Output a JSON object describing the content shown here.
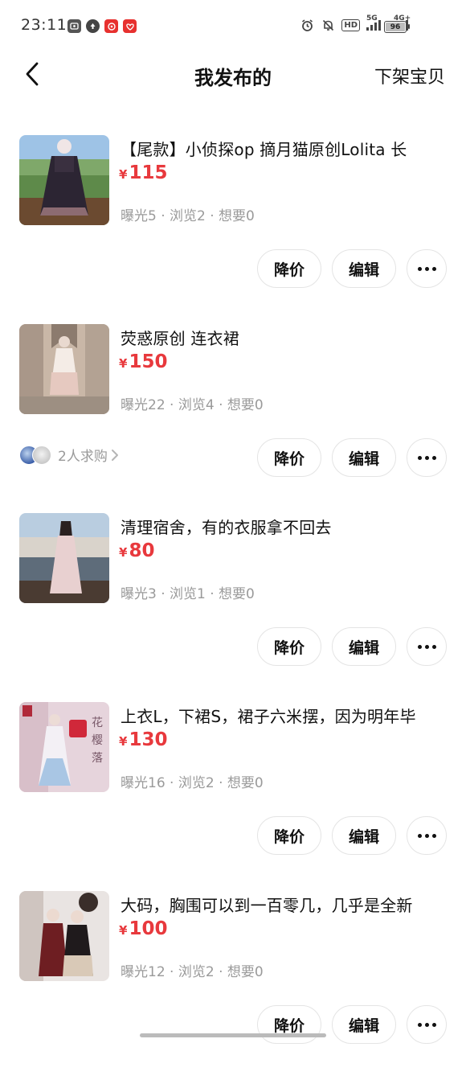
{
  "status_bar": {
    "time": "23:11",
    "battery": "96",
    "hd": "HD",
    "net1": "5G",
    "net2": "4G+"
  },
  "nav": {
    "title": "我发布的",
    "delist_label": "下架宝贝"
  },
  "items": [
    {
      "title": "【尾款】小侦探op 摘月猫原创Lolita 长",
      "price_symbol": "¥",
      "price": "115",
      "stats": "曝光5 · 浏览2 · 想要0",
      "reduce_label": "降价",
      "edit_label": "编辑"
    },
    {
      "title": "荧惑原创 连衣裙",
      "price_symbol": "¥",
      "price": "150",
      "stats": "曝光22 · 浏览4 · 想要0",
      "buy_request": "2人求购",
      "reduce_label": "降价",
      "edit_label": "编辑"
    },
    {
      "title": "清理宿舍，有的衣服拿不回去",
      "price_symbol": "¥",
      "price": "80",
      "stats": "曝光3 · 浏览1 · 想要0",
      "reduce_label": "降价",
      "edit_label": "编辑"
    },
    {
      "title": "上衣L，下裙S，裙子六米摆，因为明年毕",
      "price_symbol": "¥",
      "price": "130",
      "stats": "曝光16 · 浏览2 · 想要0",
      "reduce_label": "降价",
      "edit_label": "编辑"
    },
    {
      "title": "大码，胸围可以到一百零几，几乎是全新",
      "price_symbol": "¥",
      "price": "100",
      "stats": "曝光12 · 浏览2 · 想要0",
      "reduce_label": "降价",
      "edit_label": "编辑"
    }
  ],
  "icons": {
    "back": "chevron-left-icon",
    "more": "more-dots-icon",
    "chevron": "chevron-right-icon"
  },
  "colors": {
    "price": "#e8393d",
    "stats": "#9a9a9a",
    "pill_border": "#e4e4e4"
  }
}
